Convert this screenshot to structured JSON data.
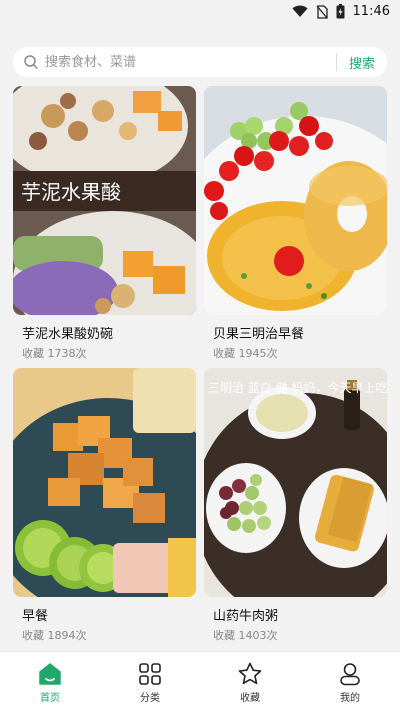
{
  "status_bar": {
    "time": "11:46",
    "icons": [
      "wifi-icon",
      "no-sim-icon",
      "battery-icon"
    ]
  },
  "search": {
    "placeholder": "搜索食材、菜谱",
    "button_label": "搜索"
  },
  "colors": {
    "accent": "#22a86a",
    "background": "#f2f2f2"
  },
  "recipes": [
    {
      "title": "芋泥水果酸奶碗",
      "stat": "收藏 1738次",
      "image_text": "芋泥水果酸"
    },
    {
      "title": "贝果三明治早餐",
      "stat": "收藏 1945次"
    },
    {
      "title": "早餐",
      "stat": "收藏 1894次"
    },
    {
      "title": "山药牛肉粥",
      "stat": "收藏 1403次",
      "image_text": "三明治 蓝白 健 妈妈，今天早上吃的"
    }
  ],
  "tabbar": [
    {
      "label": "首页",
      "icon": "home-icon",
      "active": true
    },
    {
      "label": "分类",
      "icon": "grid-icon",
      "active": false
    },
    {
      "label": "收藏",
      "icon": "star-icon",
      "active": false
    },
    {
      "label": "我的",
      "icon": "user-icon",
      "active": false
    }
  ]
}
